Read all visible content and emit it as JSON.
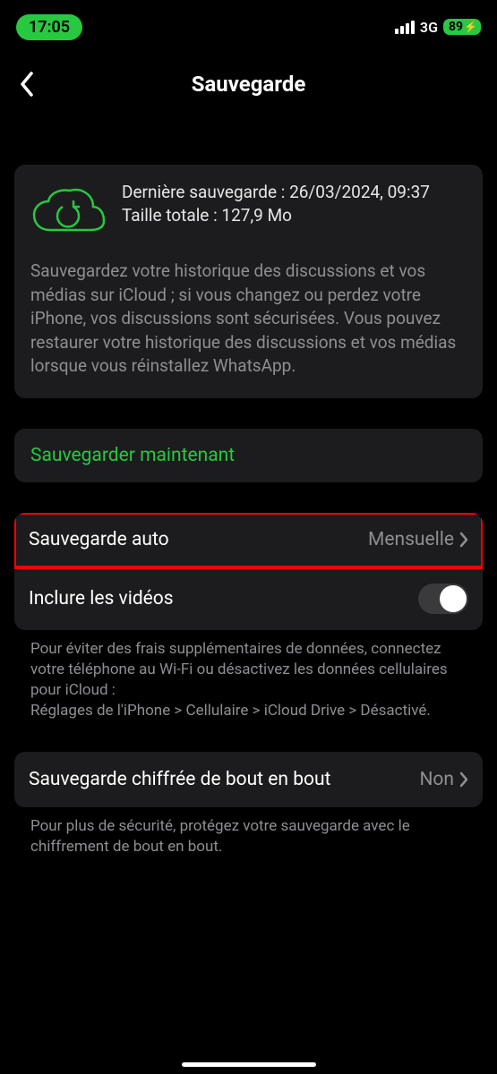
{
  "status": {
    "time": "17:05",
    "network": "3G",
    "battery": "89"
  },
  "nav": {
    "title": "Sauvegarde"
  },
  "backup_info": {
    "last_backup": "Dernière sauvegarde : 26/03/2024, 09:37",
    "total_size": "Taille totale : 127,9 Mo",
    "description": "Sauvegardez votre historique des discussions et vos médias sur iCloud ; si vous changez ou perdez votre iPhone, vos discussions sont sécurisées. Vous pouvez restaurer votre historique des discussions et vos médias lorsque vous réinstallez WhatsApp."
  },
  "actions": {
    "backup_now": "Sauvegarder maintenant"
  },
  "settings": {
    "auto_backup_label": "Sauvegarde auto",
    "auto_backup_value": "Mensuelle",
    "include_videos_label": "Inclure les vidéos",
    "include_videos_on": false,
    "data_note": "Pour éviter des frais supplémentaires de données, connectez votre téléphone au Wi-Fi ou désactivez les données cellulaires pour iCloud :\nRéglages de l'iPhone > Cellulaire > iCloud Drive > Désactivé.",
    "encrypted_label": "Sauvegarde chiffrée de bout en bout",
    "encrypted_value": "Non",
    "encrypted_note": "Pour plus de sécurité, protégez votre sauvegarde avec le chiffrement de bout en bout."
  },
  "colors": {
    "accent": "#28c840"
  }
}
